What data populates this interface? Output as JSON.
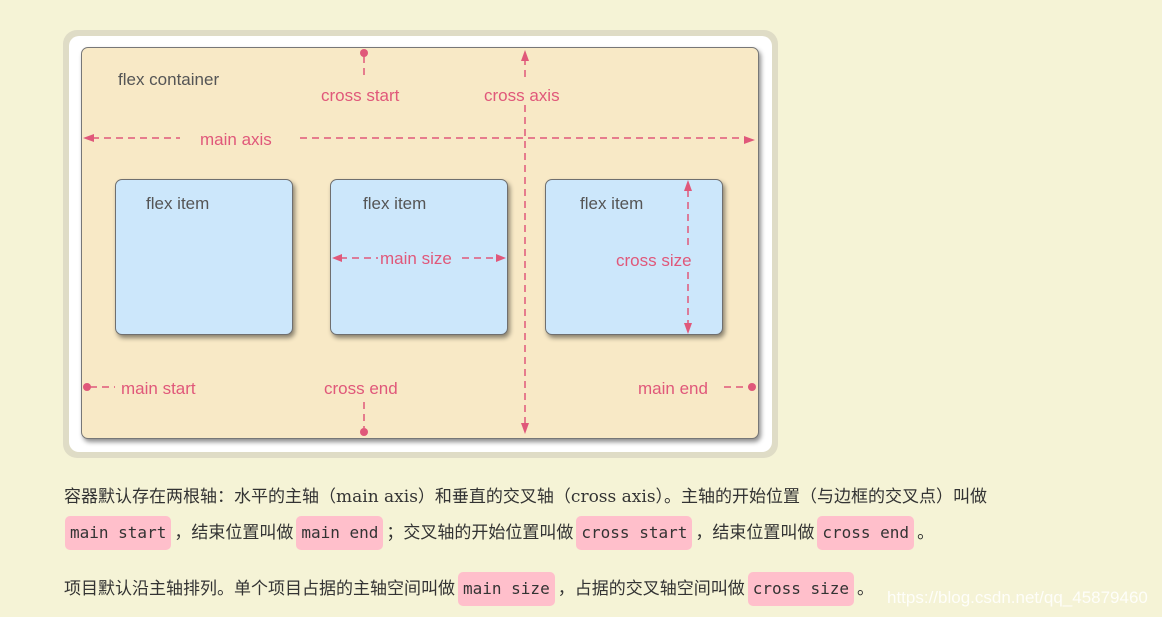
{
  "diagram": {
    "container_label": "flex container",
    "axis_labels": {
      "cross_start": "cross start",
      "cross_axis": "cross axis",
      "main_axis": "main axis",
      "main_start": "main start",
      "cross_end": "cross end",
      "main_end": "main end",
      "main_size": "main size",
      "cross_size": "cross size"
    },
    "items": [
      {
        "label": "flex item"
      },
      {
        "label": "flex item"
      },
      {
        "label": "flex item"
      }
    ],
    "colors": {
      "accent": "#e0587a",
      "container_bg": "#f8e9c6",
      "item_bg": "#cce7fb"
    }
  },
  "paragraph1": {
    "line1": "容器默认存在两根轴：水平的主轴（main axis）和垂直的交叉轴（cross axis）。主轴的开始位置（与边框的交叉点）叫做",
    "code1": "main start",
    "text2": "，结束位置叫做",
    "code2": "main end",
    "text3": "；交叉轴的开始位置叫做",
    "code3": "cross start",
    "text4": "，结束位置叫做",
    "code4": "cross end",
    "text5": "。"
  },
  "paragraph2": {
    "text1": "项目默认沿主轴排列。单个项目占据的主轴空间叫做",
    "code1": "main size",
    "text2": "，占据的交叉轴空间叫做",
    "code2": "cross size",
    "text3": "。"
  },
  "watermark": "https://blog.csdn.net/qq_45879460",
  "highlight_color": "#ffbfcb"
}
